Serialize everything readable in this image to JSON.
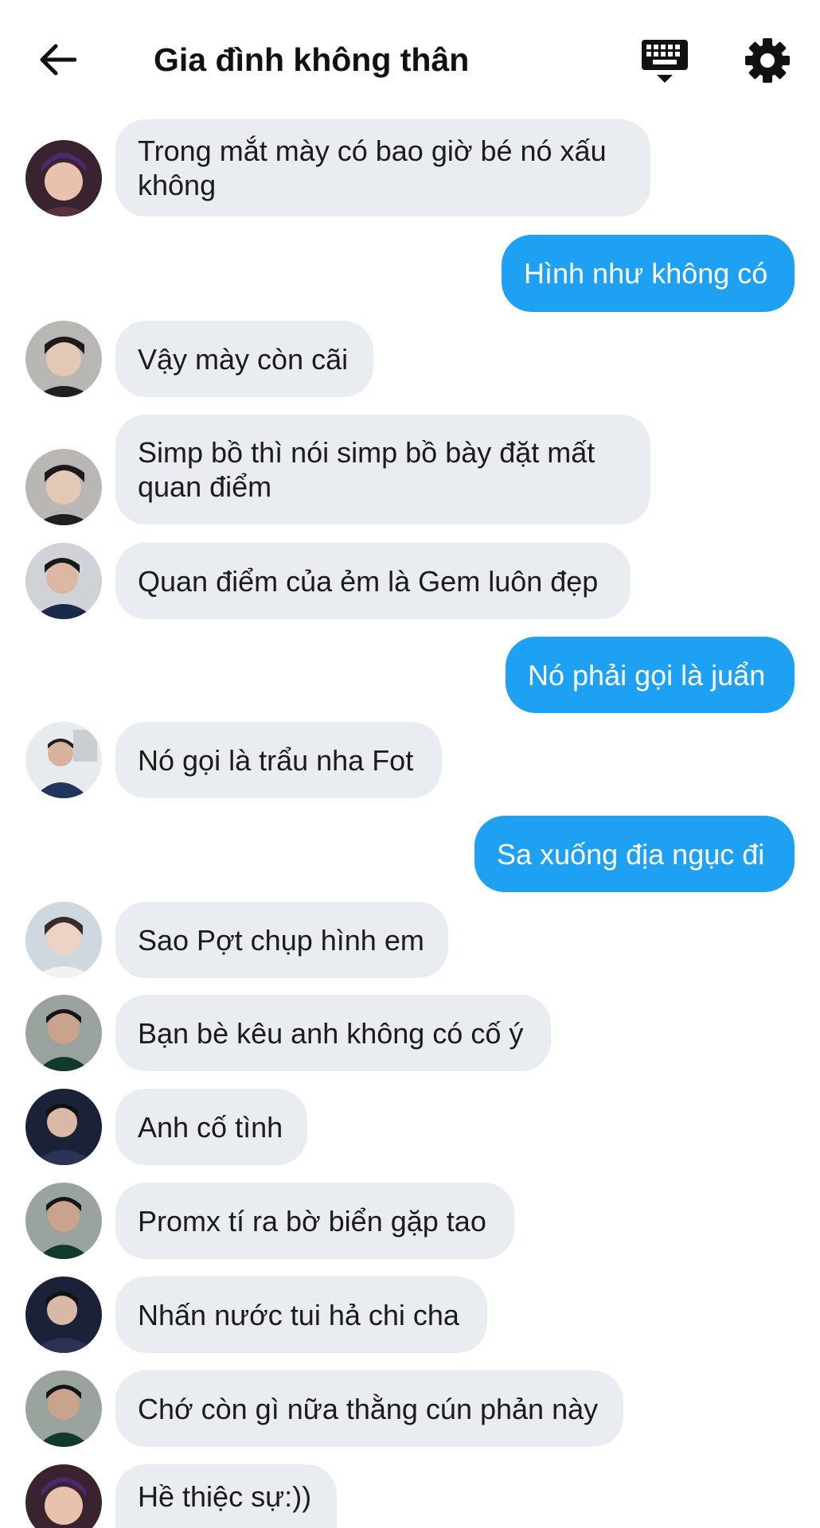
{
  "header": {
    "title": "Gia đình không thân"
  },
  "icons": {
    "back": "arrow-left-icon",
    "keyboard": "keyboard-icon",
    "settings": "gear-icon"
  },
  "colors": {
    "outgoing_bubble": "#1ea1f2",
    "incoming_bubble": "#e9ecf0",
    "background": "#ffffff"
  },
  "messages": [
    {
      "direction": "in",
      "text": "Trong mắt mày có bao giờ bé nó xấu\nkhông",
      "avatar": "avatar-a"
    },
    {
      "direction": "out",
      "text": "Hình như không có"
    },
    {
      "direction": "in",
      "text": "Vậy mày còn cãi",
      "avatar": "avatar-b"
    },
    {
      "direction": "in",
      "text": "Simp bồ thì nói simp bồ bày đặt mất\nquan điểm",
      "avatar": "avatar-b"
    },
    {
      "direction": "in",
      "text": "Quan điểm của ẻm là Gem luôn đẹp",
      "avatar": "avatar-c"
    },
    {
      "direction": "out",
      "text": "Nó phải gọi là juẩn"
    },
    {
      "direction": "in",
      "text": "Nó gọi là trẩu nha Fot",
      "avatar": "avatar-d"
    },
    {
      "direction": "out",
      "text": "Sa xuống địa ngục đi"
    },
    {
      "direction": "in",
      "text": "Sao Pợt chụp hình em",
      "avatar": "avatar-e"
    },
    {
      "direction": "in",
      "text": "Bạn bè kêu anh không có cố ý",
      "avatar": "avatar-f"
    },
    {
      "direction": "in",
      "text": "Anh cố tình",
      "avatar": "avatar-g"
    },
    {
      "direction": "in",
      "text": "Promx tí ra bờ biển gặp tao",
      "avatar": "avatar-f"
    },
    {
      "direction": "in",
      "text": "Nhấn nước tui hả chi cha",
      "avatar": "avatar-g"
    },
    {
      "direction": "in",
      "text": "Chớ còn gì nữa thằng cún phản này",
      "avatar": "avatar-f"
    },
    {
      "direction": "in",
      "text": "Hề thiệc sự:))",
      "avatar": "avatar-a"
    }
  ]
}
